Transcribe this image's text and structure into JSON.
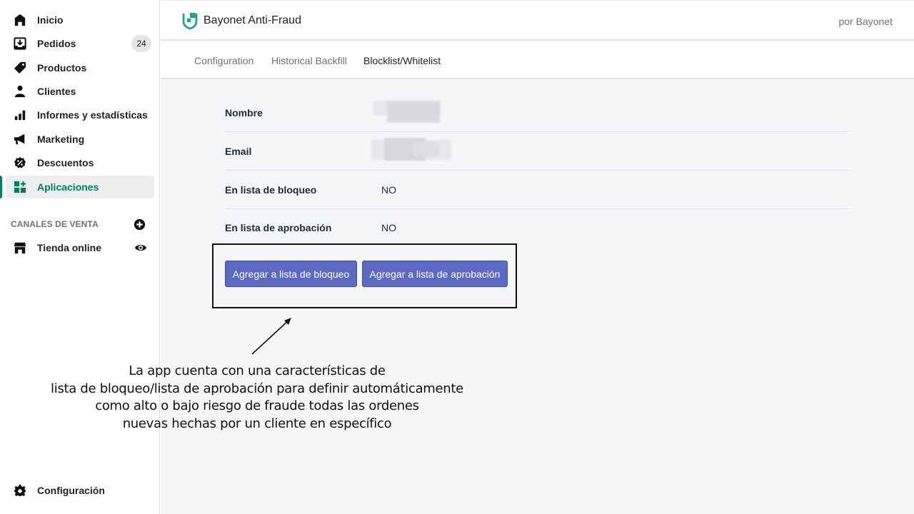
{
  "sidebar": {
    "items": [
      {
        "label": "Inicio",
        "icon": "home-icon"
      },
      {
        "label": "Pedidos",
        "icon": "orders-icon",
        "badge": "24"
      },
      {
        "label": "Productos",
        "icon": "tag-icon"
      },
      {
        "label": "Clientes",
        "icon": "person-icon"
      },
      {
        "label": "Informes y estadísticas",
        "icon": "bar-chart-icon"
      },
      {
        "label": "Marketing",
        "icon": "megaphone-icon"
      },
      {
        "label": "Descuentos",
        "icon": "discount-icon"
      },
      {
        "label": "Aplicaciones",
        "icon": "apps-icon",
        "active": true
      }
    ],
    "sales_channels": {
      "title": "CANALES DE VENTA",
      "items": [
        {
          "label": "Tienda online",
          "icon": "store-icon",
          "action_icon": "eye-icon"
        }
      ]
    },
    "settings": {
      "label": "Configuración",
      "icon": "gear-icon"
    }
  },
  "app_header": {
    "title": "Bayonet Anti-Fraud",
    "by": "por Bayonet",
    "logo_icon": "bayonet-shield-icon",
    "accent_color": "#21a38b"
  },
  "tabs": [
    {
      "label": "Configuration",
      "active": false
    },
    {
      "label": "Historical Backfill",
      "active": false
    },
    {
      "label": "Blocklist/Whitelist",
      "active": true
    }
  ],
  "customer_details": [
    {
      "label": "Nombre",
      "value": "",
      "redacted": true
    },
    {
      "label": "Email",
      "value": "",
      "redacted": true
    },
    {
      "label": "En lista de bloqueo",
      "value": "NO"
    },
    {
      "label": "En lista de aprobación",
      "value": "NO"
    }
  ],
  "actions": {
    "add_blocklist": "Agregar a lista de bloqueo",
    "add_approvallist": "Agregar a lista de aprobación",
    "button_color": "#5c6ac4"
  },
  "annotation": {
    "lines": [
      "La app cuenta con una características de",
      "lista de bloqueo/lista de aprobación para definir automáticamente",
      "como alto o bajo riesgo de fraude todas las ordenes",
      "nuevas hechas por un cliente en específico"
    ]
  }
}
